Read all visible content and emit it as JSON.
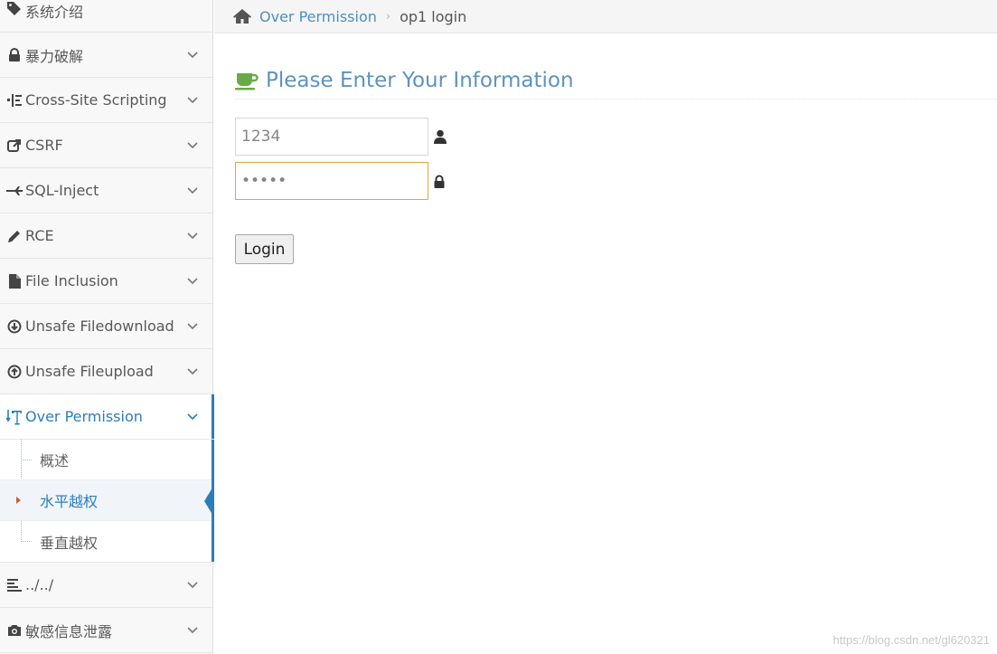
{
  "sidebar": {
    "items": [
      {
        "label": "系统介绍",
        "icon": "tags-icon"
      },
      {
        "label": "暴力破解",
        "icon": "lock-icon"
      },
      {
        "label": "Cross-Site Scripting",
        "icon": "indent-icon"
      },
      {
        "label": "CSRF",
        "icon": "share-icon"
      },
      {
        "label": "SQL-Inject",
        "icon": "fighter-jet-icon"
      },
      {
        "label": "RCE",
        "icon": "pencil-icon"
      },
      {
        "label": "File Inclusion",
        "icon": "file-icon"
      },
      {
        "label": "Unsafe Filedownload",
        "icon": "download-circle-icon"
      },
      {
        "label": "Unsafe Fileupload",
        "icon": "upload-circle-icon"
      },
      {
        "label": "Over Permission",
        "icon": "text-height-icon"
      },
      {
        "label": "../../",
        "icon": "align-left-icon"
      },
      {
        "label": "敏感信息泄露",
        "icon": "camera-icon"
      }
    ],
    "submenu": [
      {
        "label": "概述"
      },
      {
        "label": "水平越权"
      },
      {
        "label": "垂直越权"
      }
    ]
  },
  "breadcrumb": {
    "link": "Over Permission",
    "separator": "›",
    "current": "op1 login"
  },
  "main": {
    "heading": "Please Enter Your Information",
    "username_value": "1234",
    "password_value": "•••••",
    "login_label": "Login"
  },
  "colors": {
    "accent": "#2b7dbc",
    "heading": "#5d93bf",
    "cup_icon": "#69aa46",
    "focus_border": "#e0a73f"
  },
  "watermark": "https://blog.csdn.net/gl620321"
}
